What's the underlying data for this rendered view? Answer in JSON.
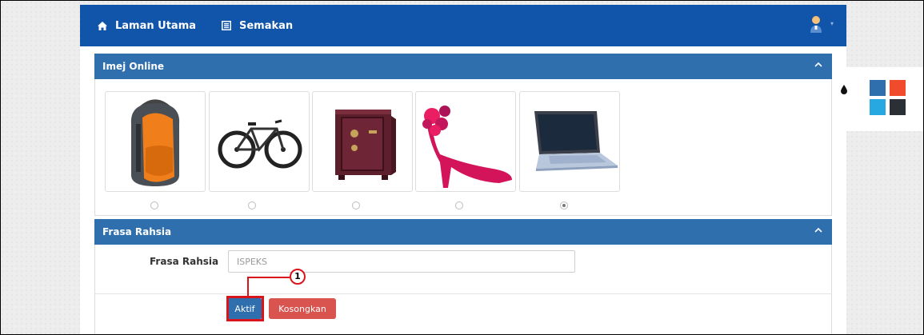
{
  "navbar": {
    "home_label": "Laman Utama",
    "check_label": "Semakan"
  },
  "image_panel": {
    "title": "Imej Online",
    "images": [
      {
        "name": "backpack",
        "selected": false
      },
      {
        "name": "bicycle",
        "selected": false
      },
      {
        "name": "safe",
        "selected": false
      },
      {
        "name": "high-heel",
        "selected": false
      },
      {
        "name": "laptop",
        "selected": true
      }
    ]
  },
  "phrase_panel": {
    "title": "Frasa Rahsia",
    "field_label": "Frasa Rahsia",
    "field_value": "ISPEKS"
  },
  "buttons": {
    "activate_label": "Aktif",
    "clear_label": "Kosongkan"
  },
  "callout": {
    "number": "1"
  },
  "theme": {
    "colors": [
      "#2f6fae",
      "#f04b2c",
      "#28a8e0",
      "#2b3036"
    ]
  }
}
